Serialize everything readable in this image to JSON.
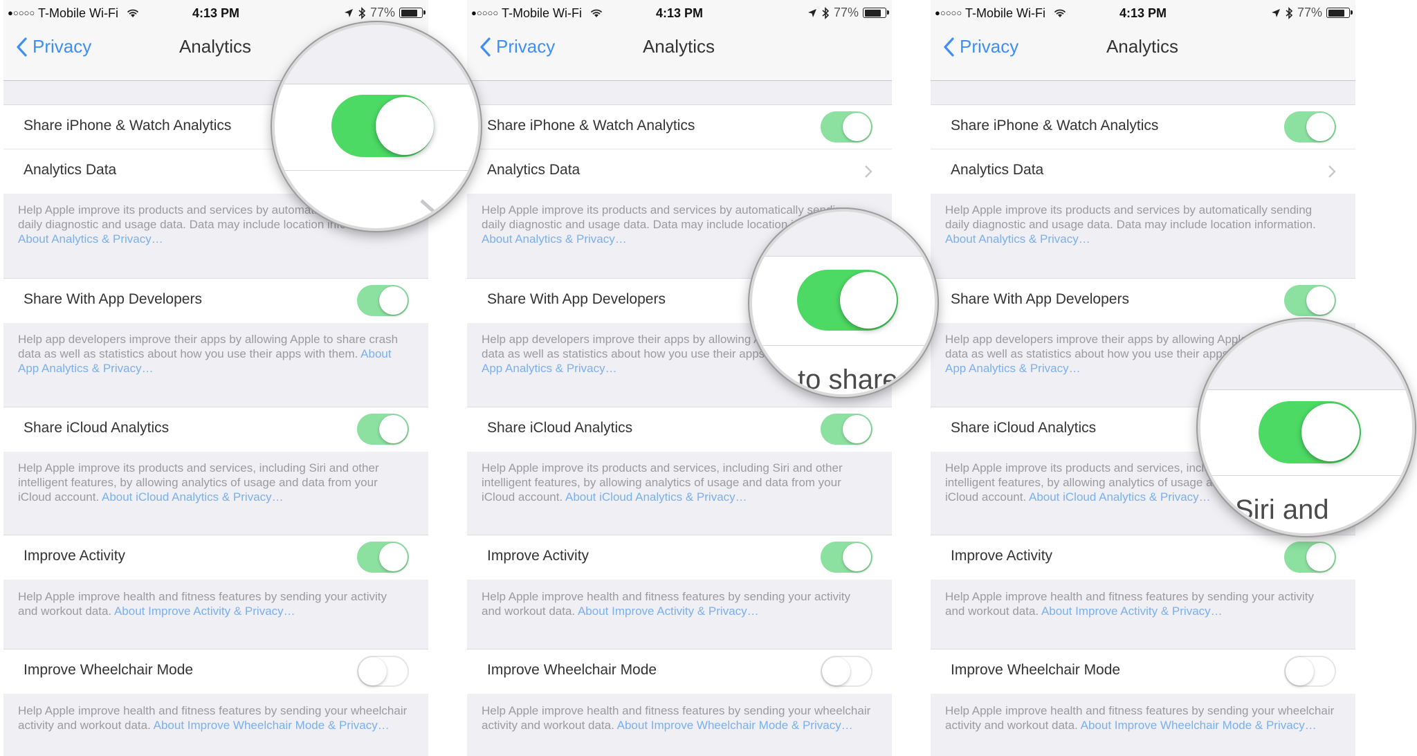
{
  "colors": {
    "accent": "#3d8ff5",
    "switch_on_dimmed": "#8ce1a0",
    "switch_on": "#4cd964",
    "link": "#7ab0ee"
  },
  "status_bar": {
    "carrier_dots": "●○○○○",
    "carrier": "T-Mobile Wi-Fi",
    "time": "4:13 PM",
    "battery": "77%",
    "icons": [
      "wifi-icon",
      "location-arrow-icon",
      "bluetooth-icon",
      "battery-icon"
    ]
  },
  "nav": {
    "back_label": "Privacy",
    "title": "Analytics"
  },
  "rows": {
    "share_iphone_watch": "Share iPhone & Watch Analytics",
    "analytics_data": "Analytics Data",
    "share_app_devs": "Share With App Developers",
    "share_icloud": "Share iCloud Analytics",
    "improve_activity": "Improve Activity",
    "improve_wheelchair": "Improve Wheelchair Mode"
  },
  "toggles": {
    "share_iphone_watch": true,
    "share_app_devs": true,
    "share_icloud": true,
    "improve_activity": true,
    "improve_wheelchair": false
  },
  "footers": {
    "analytics": {
      "text": "Help Apple improve its products and services by automatically sending daily diagnostic and usage data. Data may include location information.",
      "link": "About Analytics & Privacy…"
    },
    "app_devs": {
      "text": "Help app developers improve their apps by allowing Apple to share crash data as well as statistics about how you use their apps with them.",
      "link": "About App Analytics & Privacy…"
    },
    "icloud": {
      "text": "Help Apple improve its products and services, including Siri and other intelligent features, by allowing analytics of usage and data from your iCloud account.",
      "link": "About iCloud Analytics & Privacy…"
    },
    "activity": {
      "text": "Help Apple improve health and fitness features by sending your activity and workout data.",
      "link": "About Improve Activity & Privacy…"
    },
    "wheelchair": {
      "text": "Help Apple improve health and fitness features by sending your wheelchair activity and workout data.",
      "link": "About Improve Wheelchair Mode & Privacy…"
    }
  },
  "magnifier_text": {
    "panel2": "to share",
    "panel3": "Siri and"
  }
}
